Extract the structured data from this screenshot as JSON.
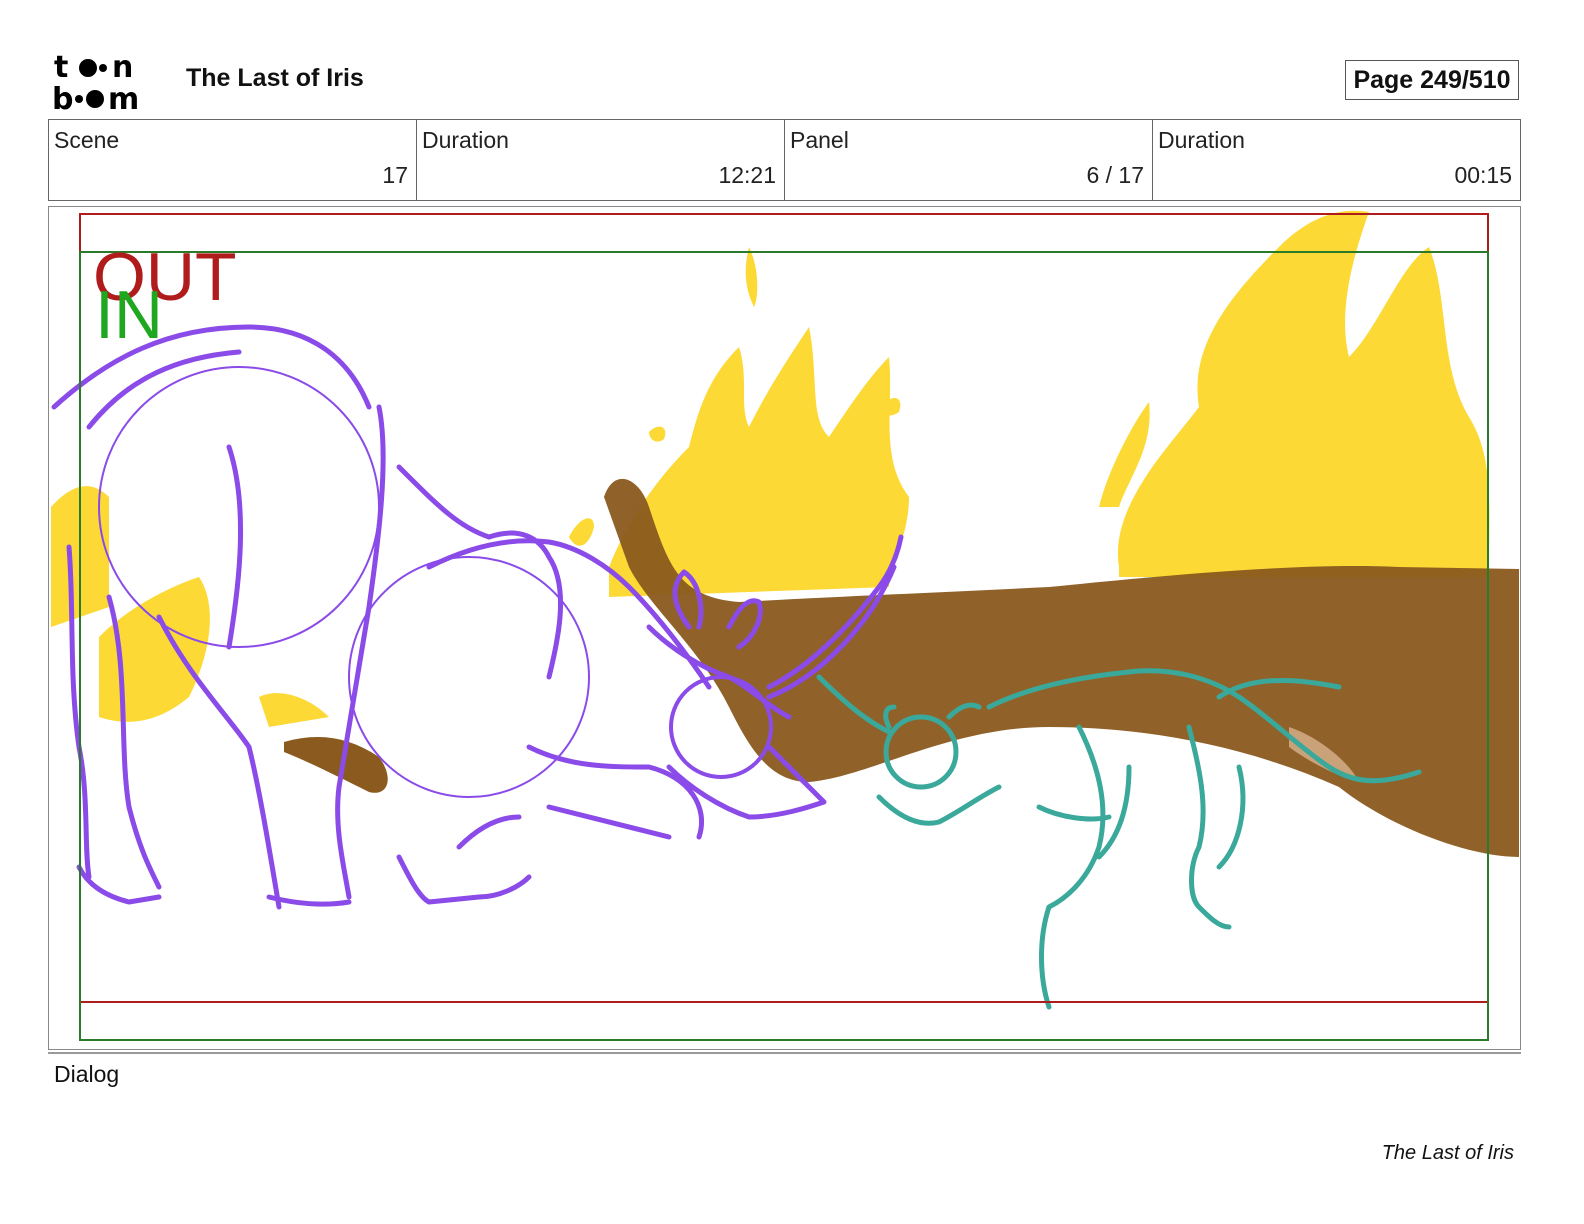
{
  "header": {
    "logo_text": "toon boom",
    "project_title": "The Last of Iris",
    "page_indicator": "Page 249/510"
  },
  "info": {
    "scene_label": "Scene",
    "scene_value": "17",
    "scene_duration_label": "Duration",
    "scene_duration_value": "12:21",
    "panel_label": "Panel",
    "panel_value": "6 / 17",
    "panel_duration_label": "Duration",
    "panel_duration_value": "00:15"
  },
  "panel": {
    "out_marker": "OUT",
    "in_marker": "IN",
    "colors": {
      "out_frame": "#b01c1c",
      "in_frame": "#2a7a2a",
      "in_text": "#1fa81f",
      "sketch_purple": "#8a4be8",
      "sketch_teal": "#3aa89a",
      "fire": "#fcd935",
      "ground": "#8a5a1f"
    }
  },
  "dialog": {
    "label": "Dialog"
  },
  "footer": {
    "title": "The Last of Iris"
  }
}
